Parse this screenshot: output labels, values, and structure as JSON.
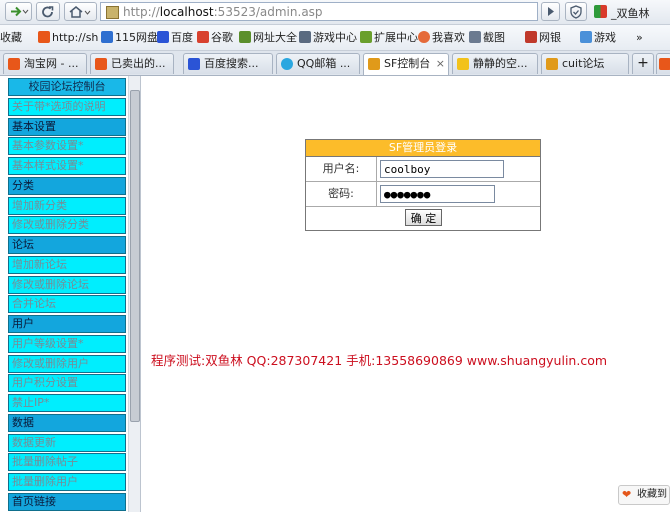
{
  "browser": {
    "address": {
      "protocol": "http://",
      "host": "localhost",
      "rest": ":53523/admin.asp"
    },
    "account_name": "_双鱼林",
    "favorites": [
      "收藏",
      "http://sh",
      "115网盘",
      "百度",
      "谷歌",
      "网址大全",
      "游戏中心",
      "扩展中心",
      "我喜欢",
      "截图",
      "网银",
      "游戏",
      "»"
    ],
    "tabs": [
      {
        "label": "淘宝网 - ...",
        "color": "#e8571a"
      },
      {
        "label": "已卖出的...",
        "color": "#e8571a"
      },
      {
        "label": "百度搜索...",
        "color": "#2b54d6"
      },
      {
        "label": "QQ邮箱 ...",
        "color": "#2aa7e0"
      },
      {
        "label": "SF控制台",
        "color": "#e09a1a"
      },
      {
        "label": "静静的空...",
        "color": "#f2c21b"
      },
      {
        "label": "cuit论坛",
        "color": "#e09a1a"
      }
    ],
    "new_tab_symbol": "+"
  },
  "sidebar": {
    "title": "校园论坛控制台",
    "items": [
      {
        "type": "link",
        "label": "关于带*选项的说明"
      },
      {
        "type": "head",
        "label": "基本设置"
      },
      {
        "type": "link",
        "label": "基本参数设置*"
      },
      {
        "type": "link",
        "label": "基本样式设置*"
      },
      {
        "type": "head",
        "label": "分类"
      },
      {
        "type": "link",
        "label": "增加新分类"
      },
      {
        "type": "link",
        "label": "修改或删除分类"
      },
      {
        "type": "head",
        "label": "论坛"
      },
      {
        "type": "link",
        "label": "增加新论坛"
      },
      {
        "type": "link",
        "label": "修改或删除论坛"
      },
      {
        "type": "link",
        "label": "合并论坛"
      },
      {
        "type": "head",
        "label": "用户"
      },
      {
        "type": "link",
        "label": "用户等级设置*"
      },
      {
        "type": "link",
        "label": "修改或删除用户"
      },
      {
        "type": "link",
        "label": "用户积分设置"
      },
      {
        "type": "link",
        "label": "禁止IP*"
      },
      {
        "type": "head",
        "label": "数据"
      },
      {
        "type": "link",
        "label": "数据更新"
      },
      {
        "type": "link",
        "label": "批量删除帖子"
      },
      {
        "type": "link",
        "label": "批量删除用户"
      },
      {
        "type": "head",
        "label": "首页链接"
      }
    ]
  },
  "login": {
    "header": "SF管理员登录",
    "username_label": "用户名:",
    "username_value": "coolboy",
    "password_label": "密码:",
    "password_value": "●●●●●●●",
    "submit_label": "确 定"
  },
  "credit": "程序测试:双鱼林 QQ:287307421 手机:13558690869 www.shuangyulin.com",
  "favorite_popup": "收藏到"
}
